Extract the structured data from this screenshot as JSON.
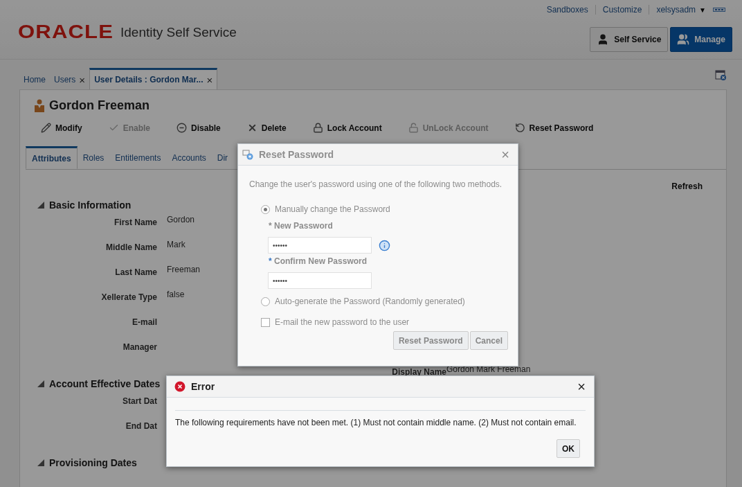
{
  "header": {
    "links": [
      "Sandboxes",
      "Customize"
    ],
    "user_menu": {
      "label": "xelsysadm",
      "arrow": "▼"
    },
    "logo": "ORACLE",
    "app_title": "Identity Self Service",
    "buttons": [
      {
        "kind": "self",
        "label": "Self Service",
        "selected": false
      },
      {
        "kind": "manage",
        "label": "Manage",
        "selected": true
      }
    ]
  },
  "tabs": [
    {
      "label": "Home",
      "selected": false
    },
    {
      "label": "Users",
      "close": "×",
      "selected": false
    },
    {
      "label": "User Details : Gordon Mar...",
      "close": "×",
      "selected": true
    }
  ],
  "user": {
    "name": "Gordon Freeman"
  },
  "actions": [
    {
      "kind": "modify",
      "label": "Modify",
      "disabled": false
    },
    {
      "kind": "enable",
      "label": "Enable",
      "disabled": true
    },
    {
      "kind": "disable",
      "label": "Disable",
      "disabled": false
    },
    {
      "kind": "delete",
      "label": "Delete",
      "disabled": false
    },
    {
      "kind": "lock",
      "label": "Lock Account",
      "disabled": false
    },
    {
      "kind": "unlock",
      "label": "UnLock Account",
      "disabled": true
    },
    {
      "kind": "reset",
      "label": "Reset Password",
      "disabled": false
    }
  ],
  "subtabs": [
    {
      "label": "Attributes",
      "selected": true
    },
    {
      "label": "Roles",
      "selected": false
    },
    {
      "label": "Entitlements",
      "selected": false
    },
    {
      "label": "Accounts",
      "selected": false
    },
    {
      "label": "Dir",
      "selected": false
    }
  ],
  "refresh": "Refresh",
  "sections": [
    {
      "title": "Basic Information",
      "expanded": true,
      "fields": [
        {
          "label": "First Name",
          "value": "Gordon"
        },
        {
          "label": "Middle Name",
          "value": "Mark"
        },
        {
          "label": "Last Name",
          "value": "Freeman"
        },
        {
          "label": "Xellerate Type",
          "value": "false"
        },
        {
          "label": "E-mail"
        },
        {
          "label": "Manager"
        }
      ]
    },
    {
      "title": "Account Effective Dates",
      "expanded": true,
      "fields": [
        {
          "label": "Start Dat"
        },
        {
          "label": "End Dat"
        }
      ]
    },
    {
      "title": "Provisioning Dates",
      "expanded": true
    }
  ],
  "side_field": {
    "label": "Display Name",
    "value": "Gordon Mark Freeman"
  },
  "reset_dialog": {
    "title": "Reset Password",
    "close": "×",
    "intro": "Change the user's password using one of the following two methods.",
    "options": [
      {
        "label": "Manually change the Password",
        "selected": true
      },
      {
        "label": "Auto-generate the Password (Randomly generated)",
        "selected": false
      }
    ],
    "new_password": {
      "label": "New Password",
      "required": "*",
      "value": "••••••"
    },
    "confirm_password": {
      "label": "Confirm New Password",
      "required": "*",
      "value": "••••••"
    },
    "email_option": {
      "label": "E-mail the new password to the user",
      "checked": false
    },
    "buttons": [
      "Reset Password",
      "Cancel"
    ]
  },
  "error_dialog": {
    "title": "Error",
    "close": "×",
    "message": "The following requirements have not been met. (1) Must not contain middle name. (2) Must not contain email.",
    "button": "OK"
  }
}
